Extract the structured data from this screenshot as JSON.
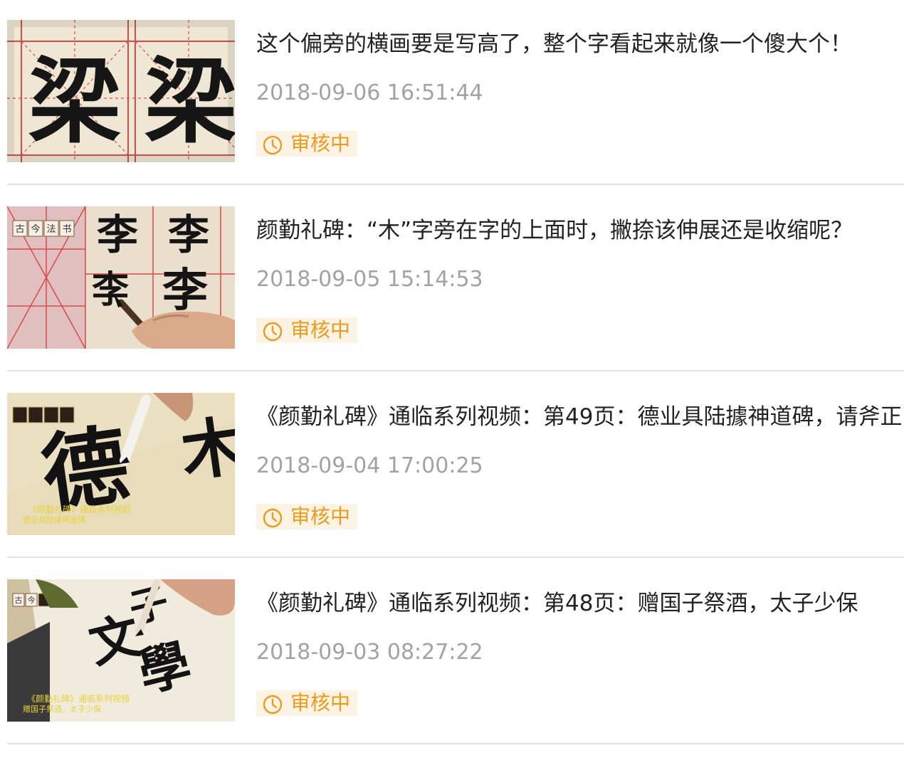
{
  "items": [
    {
      "title": "这个偏旁的横画要是写高了，整个字看起来就像一个傻大个！",
      "time": "2018-09-06 16:51:44",
      "status": "审核中",
      "thumb": {
        "glyph_a": "梁",
        "glyph_b": "梁"
      }
    },
    {
      "title": "颜勤礼碑：“木”字旁在字的上面时，撇捺该伸展还是收缩呢？",
      "time": "2018-09-05 15:14:53",
      "status": "审核中",
      "thumb": {
        "logo": [
          "古",
          "今",
          "法",
          "书"
        ],
        "glyph_a": "李",
        "glyph_b": "李",
        "glyph_c": "李",
        "glyph_d": "李"
      }
    },
    {
      "title": "《颜勤礼碑》通临系列视频：第49页：德业具陆據神道碑，请斧正",
      "time": "2018-09-04 17:00:25",
      "status": "审核中",
      "thumb": {
        "glyph_a": "德",
        "glyph_b": "木",
        "caption1": "《颜勤礼碑》通临系列视频",
        "caption2": "德业具陆據神道碑"
      }
    },
    {
      "title": "《颜勤礼碑》通临系列视频：第48页：赠国子祭酒，太子少保",
      "time": "2018-09-03 08:27:22",
      "status": "审核中",
      "thumb": {
        "logo": [
          "古",
          "今"
        ],
        "glyph_a": "文",
        "glyph_b": "學",
        "glyph_c": "子",
        "caption1": "《颜勤礼碑》通临系列视频",
        "caption2": "赠国子祭酒，太子少保"
      }
    }
  ],
  "colors": {
    "status_text": "#eb9b1e",
    "status_bg": "#fdf3e4",
    "title": "#222222",
    "time": "#a2a2a2",
    "divider": "#e3e3e3",
    "grid_red": "#d84a4a",
    "caption_yellow": "#e8d23a"
  },
  "icons": {
    "status": "clock-icon"
  }
}
